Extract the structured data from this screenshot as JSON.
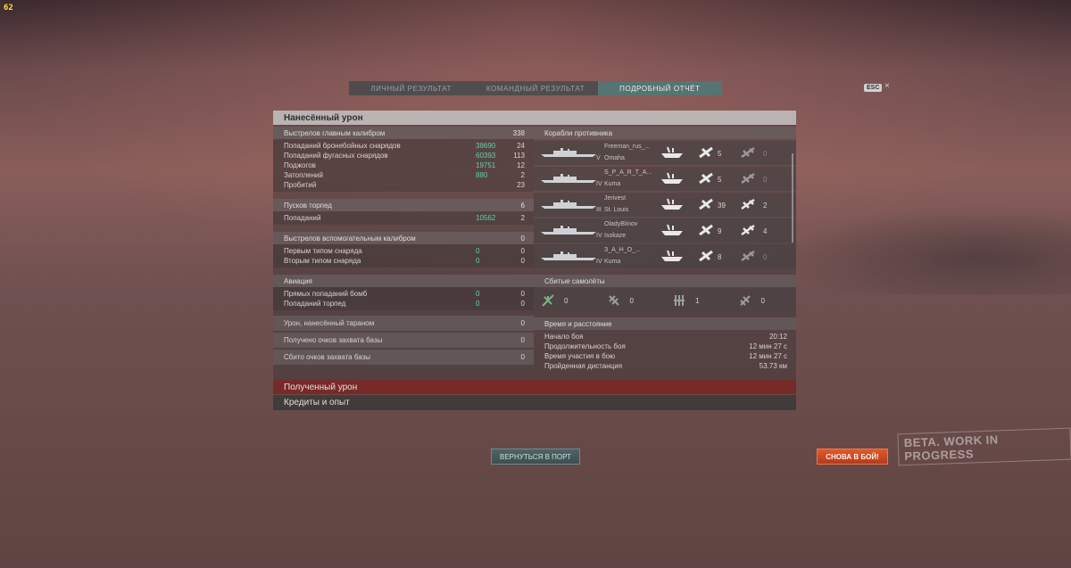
{
  "fps": "62",
  "tabs": [
    "ЛИЧНЫЙ РЕЗУЛЬТАТ",
    "КОМАНДНЫЙ РЕЗУЛЬТАТ",
    "ПОДРОБНЫЙ ОТЧЁТ"
  ],
  "active_tab": 2,
  "esc": "ESC",
  "esc_close": "×",
  "damage": {
    "title": "Нанесённый урон",
    "main": {
      "label": "Выстрелов главным калибром",
      "value": "338",
      "rows": [
        {
          "label": "Попаданий бронебойных снарядов",
          "damage": "38690",
          "count": "24"
        },
        {
          "label": "Попаданий фугасных снарядов",
          "damage": "60393",
          "count": "113"
        },
        {
          "label": "Поджогов",
          "damage": "19751",
          "count": "12"
        },
        {
          "label": "Затоплений",
          "damage": "880",
          "count": "2"
        },
        {
          "label": "Пробитий",
          "damage": "",
          "count": "23"
        }
      ]
    },
    "torpedo": {
      "label": "Пусков торпед",
      "value": "6",
      "rows": [
        {
          "label": "Попаданий",
          "damage": "10562",
          "count": "2"
        }
      ]
    },
    "secondary": {
      "label": "Выстрелов вспомогательным калибром",
      "value": "0",
      "rows": [
        {
          "label": "Первым типом снаряда",
          "damage": "0",
          "count": "0"
        },
        {
          "label": "Вторым типом снаряда",
          "damage": "0",
          "count": "0"
        }
      ]
    },
    "aviation": {
      "label": "Авиация",
      "value": "",
      "rows": [
        {
          "label": "Прямых попаданий бомб",
          "damage": "0",
          "count": "0"
        },
        {
          "label": "Попаданий торпед",
          "damage": "0",
          "count": "0"
        }
      ]
    },
    "ram": {
      "label": "Урон, нанесённый тараном",
      "value": "0"
    },
    "capture": {
      "label": "Получено очков захвата базы",
      "value": "0"
    },
    "defend": {
      "label": "Сбито очков захвата базы",
      "value": "0"
    }
  },
  "enemies": {
    "title": "Корабли противника",
    "ships": [
      {
        "player": "Freeman_rus_...",
        "ship": "Omaha",
        "tier": "V",
        "hits": "5",
        "other": "0",
        "other_lit": false
      },
      {
        "player": "S_P_A_R_T_A...",
        "ship": "Kuma",
        "tier": "IV",
        "hits": "5",
        "other": "0",
        "other_lit": false
      },
      {
        "player": "Jerivest",
        "ship": "St. Louis",
        "tier": "III",
        "hits": "39",
        "other": "2",
        "other_lit": true
      },
      {
        "player": "OladyBlinov",
        "ship": "Isokaze",
        "tier": "IV",
        "hits": "9",
        "other": "4",
        "other_lit": true
      },
      {
        "player": "З_А_Н_О_...",
        "ship": "Kuma",
        "tier": "IV",
        "hits": "8",
        "other": "0",
        "other_lit": false
      }
    ]
  },
  "planes": {
    "title": "Сбитые самолёты",
    "items": [
      {
        "icon": "fighter-icon",
        "value": "0"
      },
      {
        "icon": "torpedo-bomber-icon",
        "value": "0"
      },
      {
        "icon": "dive-bomber-icon",
        "value": "1"
      },
      {
        "icon": "scout-plane-icon",
        "value": "0"
      }
    ]
  },
  "time": {
    "title": "Время и расстояние",
    "rows": [
      {
        "label": "Начало боя",
        "value": "20:12"
      },
      {
        "label": "Продолжительность боя",
        "value": "12 мин 27 с"
      },
      {
        "label": "Время участия в бою",
        "value": "12 мин 27 с"
      },
      {
        "label": "Пройденная дистанция",
        "value": "53.73 км"
      }
    ]
  },
  "received": "Полученный урон",
  "credits": "Кредиты и опыт",
  "btn_port": "ВЕРНУТЬСЯ В ПОРТ",
  "btn_battle": "СНОВА В БОЙ!",
  "beta": "BETA. WORK IN PROGRESS",
  "colors": {
    "accent_teal": "#5fd0b0",
    "battle_button": "#d04a22",
    "received_bar": "#782826"
  }
}
